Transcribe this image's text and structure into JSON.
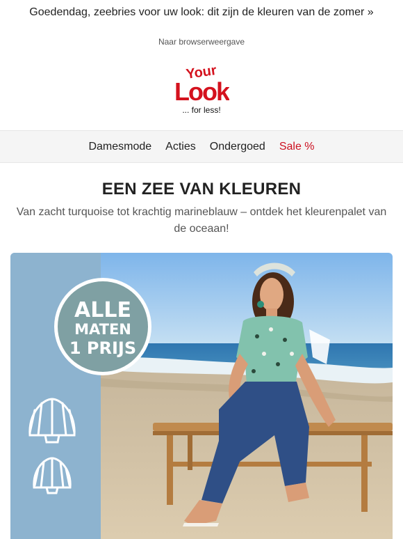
{
  "preheader": {
    "text": "Goedendag, zeebries voor uw look: dit zijn de kleuren van de zomer »"
  },
  "browser_link": {
    "text": "Naar browserweergave"
  },
  "logo": {
    "line1": "Your",
    "line2": "Look",
    "tagline": "... for less!",
    "color": "#d4121e"
  },
  "nav": {
    "items": [
      {
        "label": "Damesmode"
      },
      {
        "label": "Acties"
      },
      {
        "label": "Ondergoed"
      },
      {
        "label": "Sale %"
      }
    ],
    "sale_color": "#cc1020"
  },
  "headline": {
    "title": "EEN ZEE VAN KLEUREN",
    "subtitle": "Van zacht turquoise tot krachtig marineblauw – ontdek het kleurenpalet van de oceaan!"
  },
  "hero": {
    "badge": {
      "line1": "ALLE",
      "line2": "MATEN",
      "line3": "1 PRIJS",
      "color": "#7fa0a3"
    },
    "panel_color": "#8db3cf",
    "icons": [
      "seashell-icon",
      "seashell-icon"
    ]
  }
}
